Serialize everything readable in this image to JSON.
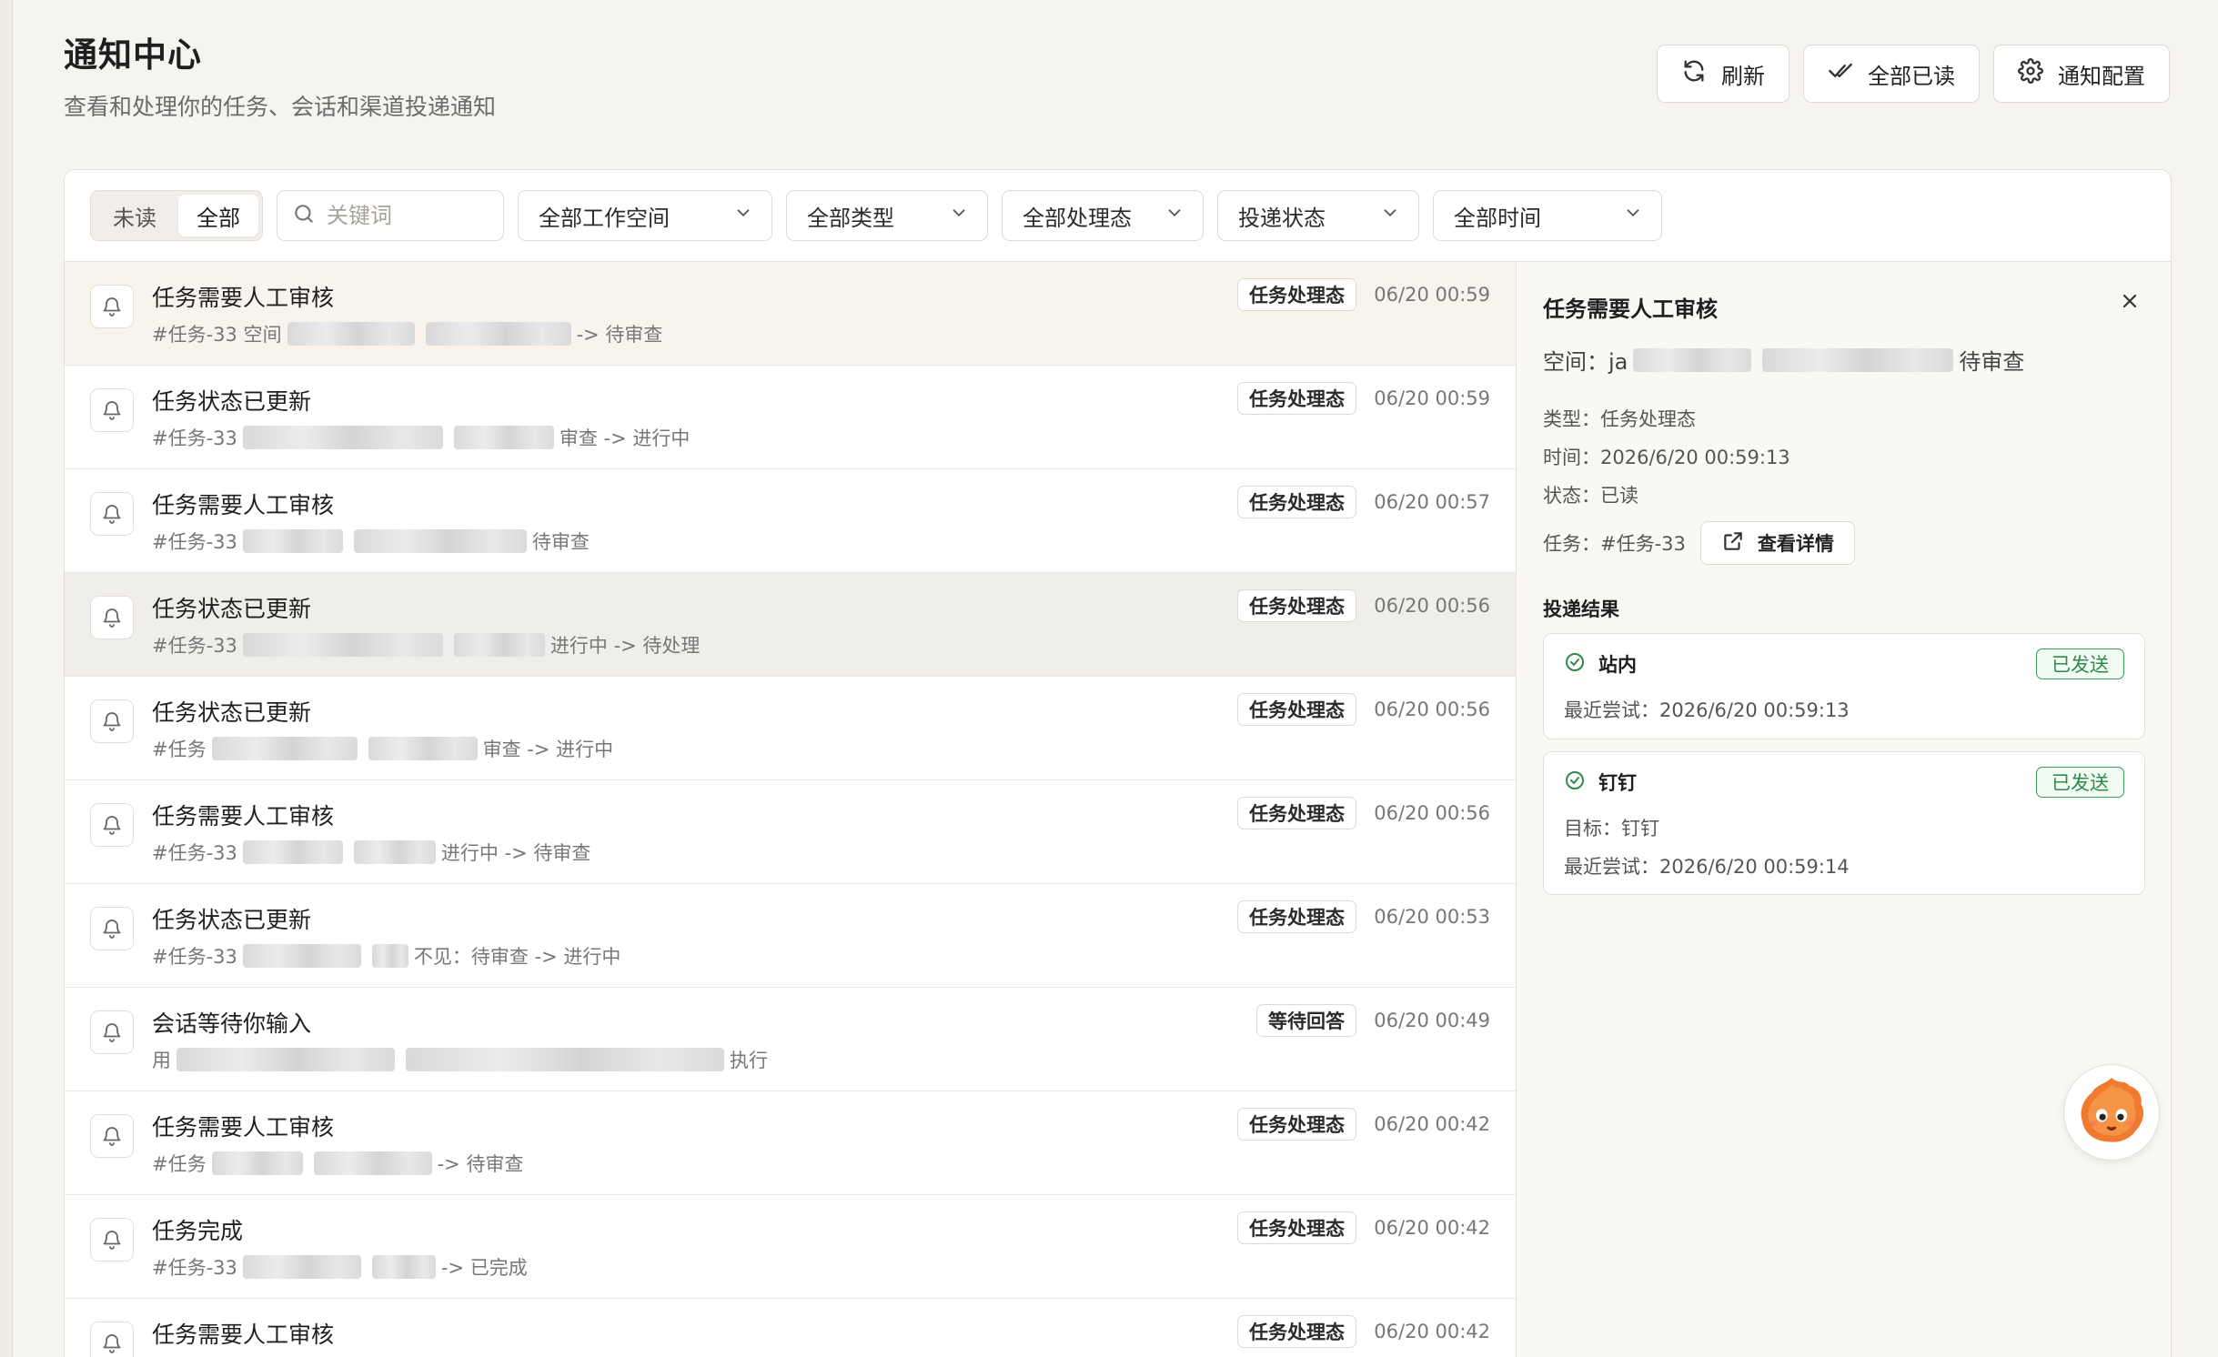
{
  "page": {
    "title": "通知中心",
    "subtitle": "查看和处理你的任务、会话和渠道投递通知"
  },
  "header_actions": {
    "refresh": "刷新",
    "mark_all_read": "全部已读",
    "settings": "通知配置"
  },
  "filters": {
    "segment_unread": "未读",
    "segment_all": "全部",
    "segment_active": "全部",
    "search_placeholder": "关键词",
    "workspace": "全部工作空间",
    "type": "全部类型",
    "handling_state": "全部处理态",
    "delivery_state": "投递状态",
    "time": "全部时间"
  },
  "notifications": [
    {
      "title": "任务需要人工审核",
      "desc_prefix": "#任务-33  空间",
      "desc_suffix": "-> 待审查",
      "tag": "任务处理态",
      "time": "06/20 00:59",
      "selected": true
    },
    {
      "title": "任务状态已更新",
      "desc_prefix": "#任务-33",
      "desc_suffix": "审查 -> 进行中",
      "tag": "任务处理态",
      "time": "06/20 00:59"
    },
    {
      "title": "任务需要人工审核",
      "desc_prefix": "#任务-33",
      "desc_suffix": "待审查",
      "tag": "任务处理态",
      "time": "06/20 00:57"
    },
    {
      "title": "任务状态已更新",
      "desc_prefix": "#任务-33",
      "desc_suffix": "进行中 -> 待处理",
      "tag": "任务处理态",
      "time": "06/20 00:56",
      "hovered": true
    },
    {
      "title": "任务状态已更新",
      "desc_prefix": "#任务",
      "desc_suffix": "审查 -> 进行中",
      "tag": "任务处理态",
      "time": "06/20 00:56"
    },
    {
      "title": "任务需要人工审核",
      "desc_prefix": "#任务-33",
      "desc_suffix": "进行中 -> 待审查",
      "tag": "任务处理态",
      "time": "06/20 00:56"
    },
    {
      "title": "任务状态已更新",
      "desc_prefix": "#任务-33",
      "desc_suffix": "不见：待审查 -> 进行中",
      "tag": "任务处理态",
      "time": "06/20 00:53"
    },
    {
      "title": "会话等待你输入",
      "desc_prefix": "用",
      "desc_suffix": "执行",
      "tag": "等待回答",
      "time": "06/20 00:49"
    },
    {
      "title": "任务需要人工审核",
      "desc_prefix": "#任务",
      "desc_suffix": "-> 待审查",
      "tag": "任务处理态",
      "time": "06/20 00:42"
    },
    {
      "title": "任务完成",
      "desc_prefix": "#任务-33",
      "desc_suffix": "-> 已完成",
      "tag": "任务处理态",
      "time": "06/20 00:42"
    },
    {
      "title": "任务需要人工审核",
      "desc_prefix": "",
      "desc_suffix": "",
      "tag": "任务处理态",
      "time": "06/20 00:42"
    }
  ],
  "detail": {
    "title": "任务需要人工审核",
    "space_label": "空间：ja",
    "space_suffix": "待审查",
    "type": "类型：任务处理态",
    "time": "时间：2026/6/20 00:59:13",
    "status": "状态：已读",
    "task": "任务：#任务-33",
    "view_details": "查看详情",
    "delivery_title": "投递结果",
    "results": [
      {
        "channel": "站内",
        "badge": "已发送",
        "lines": [
          "最近尝试：2026/6/20 00:59:13"
        ]
      },
      {
        "channel": "钉钉",
        "badge": "已发送",
        "lines": [
          "目标：钉钉",
          "最近尝试：2026/6/20 00:59:14"
        ]
      }
    ]
  },
  "colors": {
    "background": "#f6f4f0",
    "selected_row": "#f8f3ec",
    "sent_green": "#2e8a49"
  }
}
